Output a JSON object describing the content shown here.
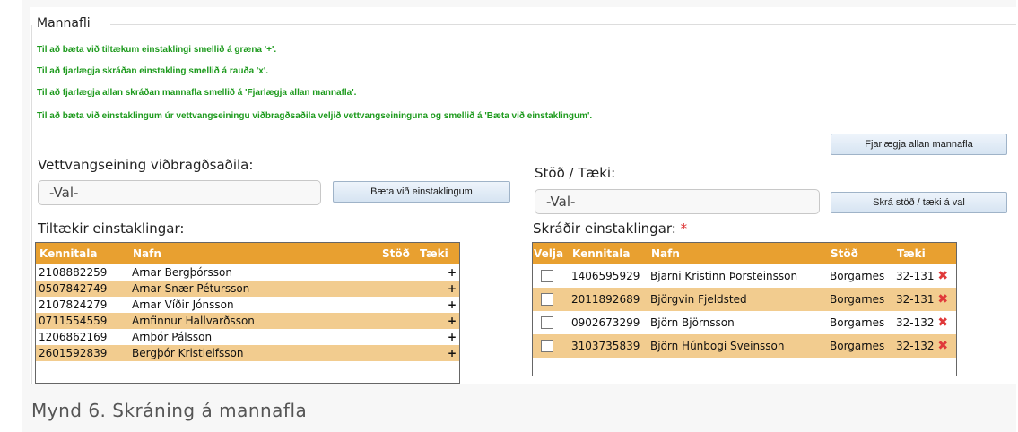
{
  "fieldset": {
    "title": "Mannafli"
  },
  "instructions": [
    "Til að bæta við tiltækum einstaklingi smellið á græna '+'.",
    "Til að fjarlægja skráðan einstakling smellið á rauða 'x'.",
    "Til að fjarlægja allan skráðan mannafla smellið á 'Fjarlægja allan mannafla'.",
    "Til að bæta við einstaklingum úr vettvangseiningu viðbragðsaðila veljið vettvangseininguna og smellið á 'Bæta við einstaklingum'."
  ],
  "remove_all_button": "Fjarlægja allan mannafla",
  "left": {
    "label": "Vettvangseining viðbragðsaðila:",
    "select_value": "-Val-",
    "add_button": "Bæta við einstaklingum",
    "table_title": "Tiltækir einstaklingar:",
    "columns": [
      "Kennitala",
      "Nafn",
      "Stöð",
      "Tæki"
    ],
    "rows": [
      {
        "kennitala": "2108882259",
        "nafn": "Arnar Bergþórsson"
      },
      {
        "kennitala": "0507842749",
        "nafn": "Arnar Snær Pétursson"
      },
      {
        "kennitala": "2107824279",
        "nafn": "Arnar Víðir Jónsson"
      },
      {
        "kennitala": "0711554559",
        "nafn": "Arnfinnur Hallvarðsson"
      },
      {
        "kennitala": "1206862169",
        "nafn": "Arnþór Pálsson"
      },
      {
        "kennitala": "2601592839",
        "nafn": "Bergþór Kristleifsson"
      }
    ],
    "add_icon": "+"
  },
  "right": {
    "label": "Stöð / Tæki:",
    "select_value": "-Val-",
    "register_button": "Skrá stöð / tæki á val",
    "table_title": "Skráðir einstaklingar:",
    "required_mark": "*",
    "columns": [
      "Velja",
      "Kennitala",
      "Nafn",
      "Stöð",
      "Tæki"
    ],
    "rows": [
      {
        "kennitala": "1406595929",
        "nafn": "Bjarni Kristinn Þorsteinsson",
        "stod": "Borgarnes",
        "taeki": "32-131"
      },
      {
        "kennitala": "2011892689",
        "nafn": "Björgvin Fjeldsted",
        "stod": "Borgarnes",
        "taeki": "32-131"
      },
      {
        "kennitala": "0902673299",
        "nafn": "Björn Björnsson",
        "stod": "Borgarnes",
        "taeki": "32-132"
      },
      {
        "kennitala": "3103735839",
        "nafn": "Björn Húnbogi Sveinsson",
        "stod": "Borgarnes",
        "taeki": "32-132"
      }
    ],
    "remove_icon": "✖"
  },
  "caption": "Mynd 6. Skráning á mannafla"
}
